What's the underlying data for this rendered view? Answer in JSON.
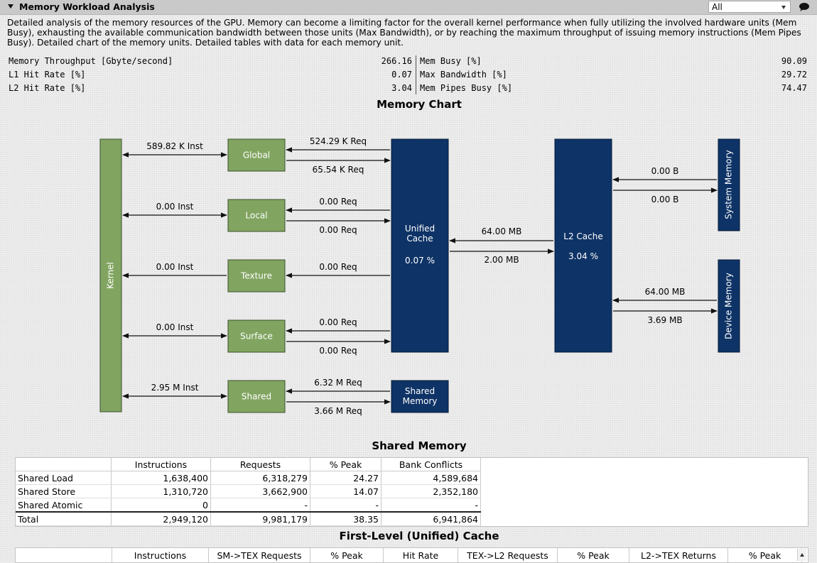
{
  "section": {
    "title": "Memory Workload Analysis",
    "filter_value": "All",
    "description": "Detailed analysis of the memory resources of the GPU. Memory can become a limiting factor for the overall kernel performance when fully utilizing the involved hardware units (Mem Busy), exhausting the available communication bandwidth between those units (Max Bandwidth), or by reaching the maximum throughput of issuing memory instructions (Mem Pipes Busy). Detailed chart of the memory units. Detailed tables with data for each memory unit."
  },
  "metrics_left": [
    {
      "label": "Memory Throughput [Gbyte/second]",
      "value": "266.16"
    },
    {
      "label": "L1 Hit Rate [%]",
      "value": "0.07"
    },
    {
      "label": "L2 Hit Rate [%]",
      "value": "3.04"
    }
  ],
  "metrics_right": [
    {
      "label": "Mem Busy [%]",
      "value": "90.09"
    },
    {
      "label": "Max Bandwidth [%]",
      "value": "29.72"
    },
    {
      "label": "Mem Pipes Busy [%]",
      "value": "74.47"
    }
  ],
  "chart": {
    "title": "Memory Chart",
    "kernel_label": "Kernel",
    "units": {
      "global": "Global",
      "local": "Local",
      "texture": "Texture",
      "surface": "Surface",
      "shared": "Shared"
    },
    "unified_cache": {
      "line1": "Unified",
      "line2": "Cache",
      "rate": "0.07 %"
    },
    "l2_cache": {
      "label": "L2 Cache",
      "rate": "3.04 %"
    },
    "shared_memory": {
      "line1": "Shared",
      "line2": "Memory"
    },
    "system_memory": "System Memory",
    "device_memory": "Device Memory",
    "flows": {
      "kernel_global": "589.82 K Inst",
      "global_uc_top": "524.29 K Req",
      "global_uc_bot": "65.54 K Req",
      "kernel_local": "0.00 Inst",
      "local_uc_top": "0.00 Req",
      "local_uc_bot": "0.00 Req",
      "kernel_texture": "0.00 Inst",
      "texture_uc": "0.00 Req",
      "kernel_surface": "0.00 Inst",
      "surface_uc_top": "0.00 Req",
      "surface_uc_bot": "0.00 Req",
      "kernel_shared": "2.95 M Inst",
      "shared_sm_top": "6.32 M Req",
      "shared_sm_bot": "3.66 M Req",
      "uc_l2_top": "64.00 MB",
      "uc_l2_bot": "2.00 MB",
      "l2_sys_top": "0.00 B",
      "l2_sys_bot": "0.00 B",
      "l2_dev_top": "64.00 MB",
      "l2_dev_bot": "3.69 MB"
    }
  },
  "shared_table": {
    "title": "Shared Memory",
    "columns": [
      "",
      "Instructions",
      "Requests",
      "% Peak",
      "Bank Conflicts"
    ],
    "rows": [
      [
        "Shared Load",
        "1,638,400",
        "6,318,279",
        "24.27",
        "4,589,684"
      ],
      [
        "Shared Store",
        "1,310,720",
        "3,662,900",
        "14.07",
        "2,352,180"
      ],
      [
        "Shared Atomic",
        "0",
        "-",
        "-",
        "-"
      ],
      [
        "Total",
        "2,949,120",
        "9,981,179",
        "38.35",
        "6,941,864"
      ]
    ]
  },
  "l1_table": {
    "title": "First-Level (Unified) Cache",
    "columns": [
      "",
      "Instructions",
      "SM->TEX Requests",
      "% Peak",
      "Hit Rate",
      "TEX->L2 Requests",
      "% Peak",
      "L2->TEX Returns",
      "% Peak"
    ]
  },
  "colors": {
    "green_box": "#81a561",
    "navy_box": "#0e3366",
    "header_bar": "#c9c9c9"
  }
}
